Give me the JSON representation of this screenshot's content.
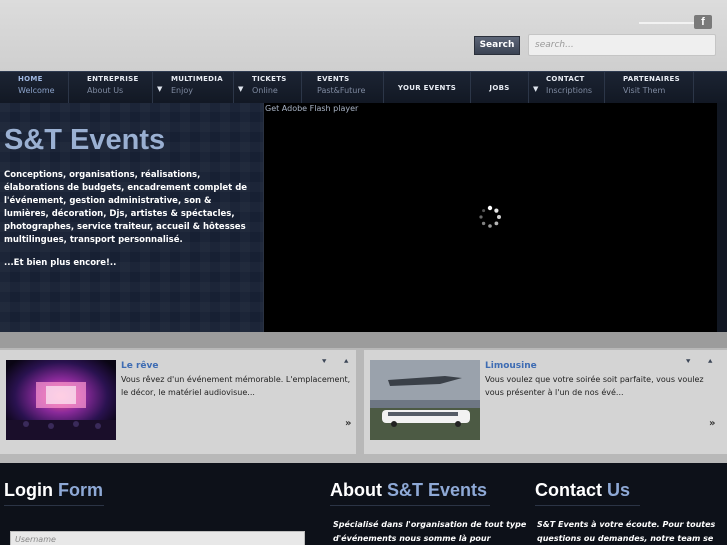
{
  "header": {
    "social_icon": "facebook-icon",
    "social_glyph": "f",
    "search_button": "Search",
    "search_placeholder": "search..."
  },
  "nav": [
    {
      "title": "HOME",
      "sub": "Welcome",
      "active": true
    },
    {
      "title": "ENTREPRISE",
      "sub": "About Us"
    },
    {
      "title": "MULTIMEDIA",
      "sub": "Enjoy",
      "dropdown": true
    },
    {
      "title": "TICKETS",
      "sub": "Online",
      "dropdown": true
    },
    {
      "title": "EVENTS",
      "sub": "Past&Future"
    },
    {
      "title": "YOUR EVENTS"
    },
    {
      "title": "JOBS"
    },
    {
      "title": "CONTACT",
      "sub": "Inscriptions",
      "dropdown": true
    },
    {
      "title": "PARTENAIRES",
      "sub": "Visit Them"
    }
  ],
  "hero": {
    "title": "S&T Events",
    "description": "Conceptions, organisations, réalisations, élaborations de budgets, encadrement complet de l'événement, gestion administrative, son & lumières, décoration, Djs, artistes & spéctacles, photographes, service traiteur, accueil & hôtesses multilingues, transport personnalisé.",
    "more": "...Et bien plus encore!..",
    "flash_label": "Get Adobe Flash player"
  },
  "news": [
    {
      "title": "Le rêve",
      "text": "Vous rêvez d'un événement mémorable. L'emplacement, le décor, le matériel audiovisue...",
      "more": "»"
    },
    {
      "title": "Limousine",
      "text": "Vous voulez que votre soirée soit parfaite, vous voulez vous présenter à l'un de nos évé...",
      "more": "»"
    }
  ],
  "footer": {
    "login": {
      "title_a": "Login",
      "title_b": "Form",
      "username_placeholder": "Username"
    },
    "about": {
      "title_a": "About",
      "title_b": "S&T Events",
      "text_1": "Spécialisé dans l'organisation de tout type",
      "text_2": "d'événements nous somme là pour"
    },
    "contact": {
      "title_a": "Contact",
      "title_b": "Us",
      "text_1": "S&T Events à votre écoute. Pour toutes",
      "text_2": "questions ou demandes, notre team se"
    }
  },
  "colors": {
    "accent": "#8ea9d6",
    "news_title": "#3e6cb3",
    "nav_bg": "#161d2b"
  }
}
